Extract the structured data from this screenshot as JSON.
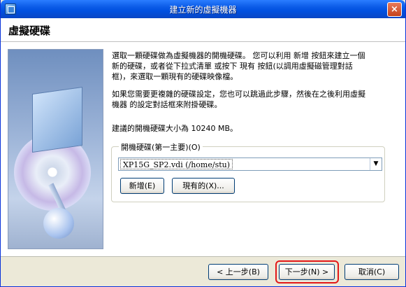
{
  "window": {
    "title": "建立新的虛擬機器",
    "close_label": "×"
  },
  "header": {
    "title": "虛擬硬碟"
  },
  "main": {
    "paragraph1_line1": "選取一顆硬碟做為虛擬機器的開機硬碟。 您可以利用 新增 按鈕來建立一個",
    "paragraph1_line2": "新的硬碟，或者從下拉式清單 或按下 現有 按鈕(以調用虛擬磁管理對話",
    "paragraph1_line3": "框)，來選取一顆現有的硬碟映像檔。",
    "paragraph2_line1": "如果您需要更複雜的硬碟設定，您也可以跳過此步驟，然後在之後利用虛擬",
    "paragraph2_line2": "機器 的設定對話框來附掛硬碟。",
    "recommended_text": "建議的開機硬碟大小為 10240 MB。"
  },
  "boot_disk": {
    "legend": "開機硬碟(第一主要)(O)",
    "selected": "XP15G_SP2.vdi (/home/stu)",
    "dropdown_arrow": "▼",
    "new_button": "新增(E)",
    "existing_button": "現有的(X)..."
  },
  "footer": {
    "back_button": "< 上一步(B)",
    "next_button": "下一步(N) >",
    "cancel_button": "取消(C)"
  },
  "colors": {
    "titlebar": "#0a5ae6",
    "highlight_border": "#e31818",
    "window_bg": "#ece9d8"
  }
}
